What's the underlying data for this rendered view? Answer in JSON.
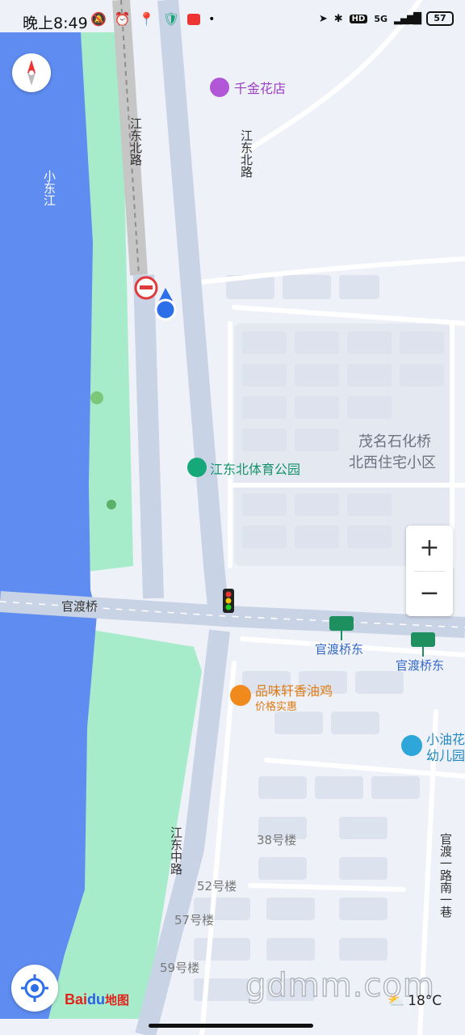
{
  "status_bar": {
    "time": "晚上8:49",
    "network": "5G",
    "hd": "HD",
    "battery": "57",
    "icons": [
      "mute-icon",
      "alarm-icon",
      "location-pin-icon",
      "shield-icon",
      "app-badge-icon",
      "navigation-arrow-icon",
      "bluetooth-icon",
      "signal-icon",
      "battery-icon"
    ]
  },
  "map": {
    "roads": {
      "jiangdong_north_rail": "江东北路",
      "jiangdong_north": "江东北路",
      "guandu_bridge": "官渡桥",
      "jiangdong_middle": "江东中路",
      "guandu_lane": "官渡一路南一巷"
    },
    "water": {
      "river": "小东江"
    },
    "pois": {
      "flower_shop": "千金花店",
      "sports_park": "江东北体育公园",
      "residential": "茂名石化桥",
      "residential_2": "北西住宅小区",
      "bus_stop_1": "官渡桥东",
      "bus_stop_2": "官渡桥东",
      "restaurant": "品味轩香油鸡",
      "restaurant_tag": "价格实惠",
      "kindergarten_1": "小油花",
      "kindergarten_2": "幼儿园",
      "bldg_38": "38号楼",
      "bldg_52": "52号楼",
      "bldg_57": "57号楼",
      "bldg_59": "59号楼"
    },
    "colors": {
      "water": "#5e8cf0",
      "green": "#a7ecca",
      "road": "#c9d3e6",
      "land": "#eef1f7",
      "poi_purple": "#b256d8",
      "poi_green": "#17a87a",
      "poi_orange": "#f08a1c",
      "bus_blue": "#3368c6"
    }
  },
  "controls": {
    "zoom_in": "+",
    "zoom_out": "−",
    "compass": "compass-icon",
    "locate": "locate-icon"
  },
  "branding": {
    "bai": "Bai",
    "du": "du",
    "ditu": "地图",
    "watermark": "gdmm.com"
  },
  "weather": {
    "temperature": "18°C",
    "icon": "cloudy-sun-icon"
  }
}
